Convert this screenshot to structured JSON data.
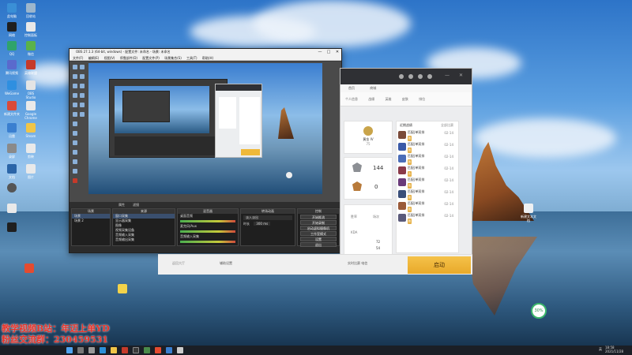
{
  "desktop": {
    "icons": [
      "此电脑",
      "回收站",
      "网络",
      "控制面板",
      "QQ",
      "微信",
      "腾讯视频",
      "英雄联盟",
      "WeGame",
      "OBS Studio",
      "新建文件夹",
      "Google Chrome",
      "迅雷",
      "Steam",
      "录屏",
      "剪映",
      "文档",
      "图片"
    ],
    "right_icon": "新建文本文档",
    "watermark_line1": "教学视频B站：年迈上单YD",
    "watermark_line2": "粉丝交流群：230459531",
    "badge_percent": "30%"
  },
  "obs": {
    "title": "OBS 27.1.3 (64-bit, windows) - 配置文件: 未命名 - 场景: 未命名",
    "menu": [
      "文件(F)",
      "编辑(E)",
      "视图(V)",
      "停靠部件(D)",
      "配置文件(P)",
      "场景集合(S)",
      "工具(T)",
      "帮助(H)"
    ],
    "source_label": "未选择源",
    "props_button": "属性",
    "filters_button": "滤镜",
    "panels": {
      "scenes": {
        "title": "场景",
        "items": [
          "场景",
          "场景 2"
        ]
      },
      "sources": {
        "title": "来源",
        "items": [
          "窗口采集",
          "显示器采集",
          "图像",
          "视频采集设备",
          "音频输入采集",
          "音频输出采集"
        ]
      },
      "mixer": {
        "title": "混音器",
        "channels": [
          "桌面音频",
          "麦克风/Aux",
          "音频输入采集"
        ],
        "db": "0.0 dB"
      },
      "transitions": {
        "title": "转场动画",
        "type": "淡入淡出",
        "duration_label": "时长",
        "duration": "300 ms"
      },
      "controls": {
        "title": "控制",
        "buttons": [
          "开始推流",
          "开始录制",
          "启动虚拟摄像机",
          "工作室模式",
          "设置",
          "退出"
        ]
      }
    },
    "status": [
      "LIVE: 00:00:00",
      "REC: 00:00:00",
      "CPU: 2.5%, 30.00 fps"
    ]
  },
  "game": {
    "tabs": [
      "首页",
      "商城"
    ],
    "subtabs": [
      "个人信息",
      "战绩",
      "英雄",
      "皮肤",
      "排位",
      "设置"
    ],
    "player": {
      "name": "黄金 IV",
      "lp": "75"
    },
    "ranks": [
      "144",
      "0"
    ],
    "stats": [
      "胜率",
      "场次",
      "KDA",
      "72",
      "54"
    ],
    "recent_title": "近期战绩",
    "recent_filter": "全部比赛",
    "matches": [
      {
        "name": "匹配|单双排",
        "kda": "02-14",
        "badge": "胜"
      },
      {
        "name": "匹配|单双排",
        "kda": "02-14",
        "badge": "胜"
      },
      {
        "name": "匹配|单双排",
        "kda": "02-14",
        "badge": "胜"
      },
      {
        "name": "匹配|单双排",
        "kda": "02-14",
        "badge": "负"
      },
      {
        "name": "匹配|单双排",
        "kda": "02-14",
        "badge": "胜"
      },
      {
        "name": "匹配|单双排",
        "kda": "02-14",
        "badge": "胜"
      },
      {
        "name": "匹配|单双排",
        "kda": "02-14",
        "badge": "胜"
      },
      {
        "name": "匹配|单双排",
        "kda": "02-14",
        "badge": "胜"
      }
    ],
    "bottom_left": "返回大厅",
    "bottom_mid": "辅助设置",
    "bottom_mid2": "实时比赛 电信",
    "start_button": "启动"
  },
  "taskbar": {
    "time": "18:58",
    "date": "2021/11/28",
    "lang": "英"
  },
  "colors": {
    "accent": "#e8a92a",
    "watermark": "#e8342a",
    "obs_bg": "#2b2b2b"
  }
}
